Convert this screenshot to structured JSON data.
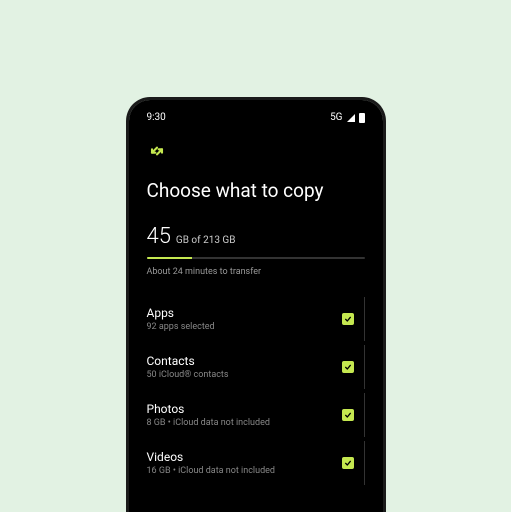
{
  "status_bar": {
    "time": "9:30",
    "network": "5G"
  },
  "header": {
    "title": "Choose what to copy"
  },
  "storage": {
    "used_value": "45",
    "used_unit": "GB of 213 GB",
    "progress_percent": 21,
    "time_estimate": "About 24 minutes to transfer"
  },
  "items": [
    {
      "label": "Apps",
      "sublabel": "92 apps selected",
      "checked": true
    },
    {
      "label": "Contacts",
      "sublabel": "50 iCloud® contacts",
      "checked": true
    },
    {
      "label": "Photos",
      "sublabel": "8 GB • iCloud data not included",
      "checked": true
    },
    {
      "label": "Videos",
      "sublabel": "16 GB • iCloud data not included",
      "checked": true
    }
  ],
  "colors": {
    "accent": "#c5e850",
    "background": "#e2f2e3"
  }
}
